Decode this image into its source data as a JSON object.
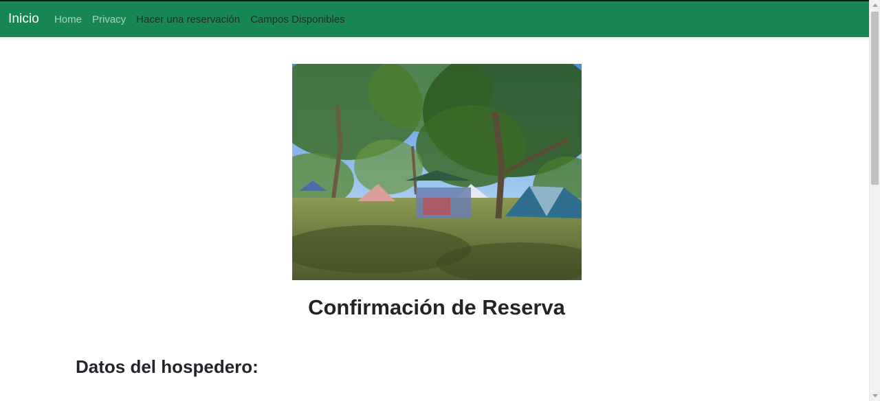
{
  "navbar": {
    "brand": "Inicio",
    "links": [
      {
        "label": "Home"
      },
      {
        "label": "Privacy"
      },
      {
        "label": "Hacer una reservación"
      },
      {
        "label": "Campos Disponibles"
      }
    ],
    "color": "#198754"
  },
  "hero": {
    "alt": "campsite-photo"
  },
  "content": {
    "title": "Confirmación de Reserva",
    "guest_section_heading": "Datos del hospedero:"
  }
}
